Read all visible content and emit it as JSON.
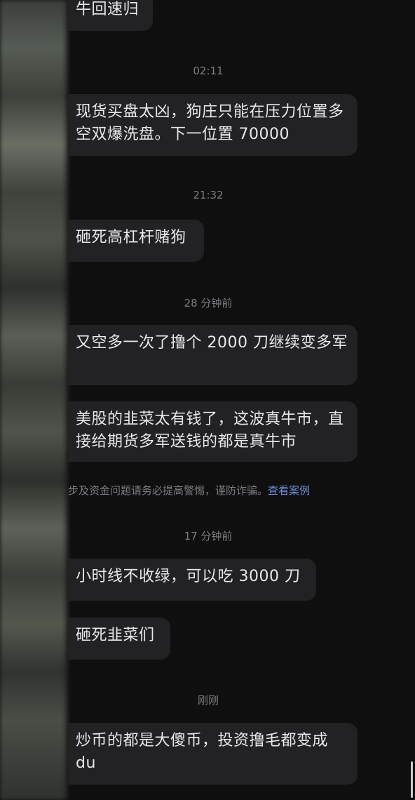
{
  "messages": [
    {
      "type": "bubble",
      "text": "牛回速归"
    },
    {
      "type": "time",
      "text": "02:11"
    },
    {
      "type": "bubble",
      "text": "现货买盘太凶，狗庄只能在压力位置多空双爆洗盘。下一位置 70000"
    },
    {
      "type": "time",
      "text": "21:32"
    },
    {
      "type": "bubble",
      "text": "砸死高杠杆赌狗"
    },
    {
      "type": "time",
      "text": "28 分钟前"
    },
    {
      "type": "bubble",
      "text": "又空多一次了撸个 2000 刀继续变多军"
    },
    {
      "type": "bubble",
      "text": "美股的韭菜太有钱了，这波真牛市，直接给期货多军送钱的都是真牛市"
    },
    {
      "type": "time",
      "text": "17 分钟前"
    },
    {
      "type": "bubble",
      "text": "小时线不收绿，可以吃 3000 刀"
    },
    {
      "type": "bubble",
      "text": "砸死韭菜们"
    },
    {
      "type": "time",
      "text": "刚刚"
    },
    {
      "type": "bubble",
      "text": "炒币的都是大傻币，投资撸毛都变成du"
    }
  ],
  "warning": {
    "text": "步及资金问题请务必提高警惕，谨防诈骗。",
    "link": "查看案例"
  }
}
